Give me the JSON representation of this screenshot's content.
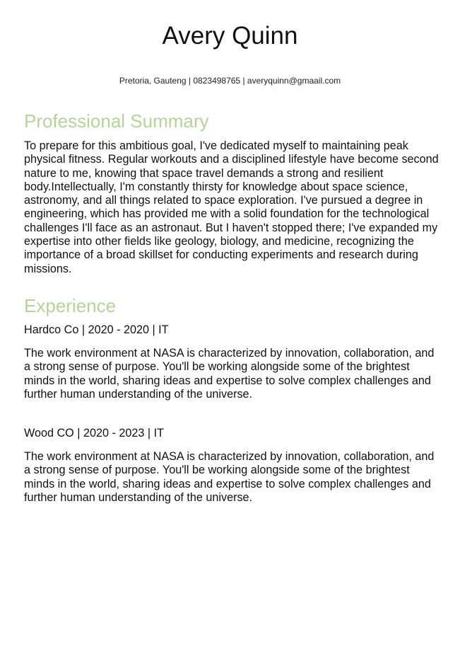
{
  "header": {
    "name": "Avery Quinn",
    "contact": "Pretoria, Gauteng | 0823498765 | averyquinn@gmaail.com"
  },
  "summary": {
    "heading": "Professional Summary",
    "text": "To prepare for this ambitious goal, I've dedicated myself to maintaining peak physical fitness. Regular workouts and a disciplined lifestyle have become second nature to me, knowing that space travel demands a strong and resilient body.Intellectually, I'm constantly thirsty for knowledge about space science, astronomy, and all things related to space exploration. I've pursued a degree in engineering, which has provided me with a solid foundation for the technological challenges I'll face as an astronaut. But I haven't stopped there; I've expanded my expertise into other fields like geology, biology, and medicine, recognizing the importance of a broad skillset for conducting experiments and research during missions."
  },
  "experience": {
    "heading": "Experience",
    "jobs": [
      {
        "title": "Hardco Co | 2020 - 2020 | IT",
        "description": "The work environment at NASA is characterized by innovation, collaboration, and a strong sense of purpose. You'll be working alongside some of the brightest minds in the world, sharing ideas and expertise to solve complex challenges and further human understanding of the universe."
      },
      {
        "title": "Wood CO | 2020 - 2023 | IT",
        "description": "The work environment at NASA is characterized by innovation, collaboration, and a strong sense of purpose. You'll be working alongside some of the brightest minds in the world, sharing ideas and expertise to solve complex challenges and further human understanding of the universe."
      }
    ]
  },
  "colors": {
    "heading_accent": "#b5d39a",
    "text": "#111111"
  }
}
